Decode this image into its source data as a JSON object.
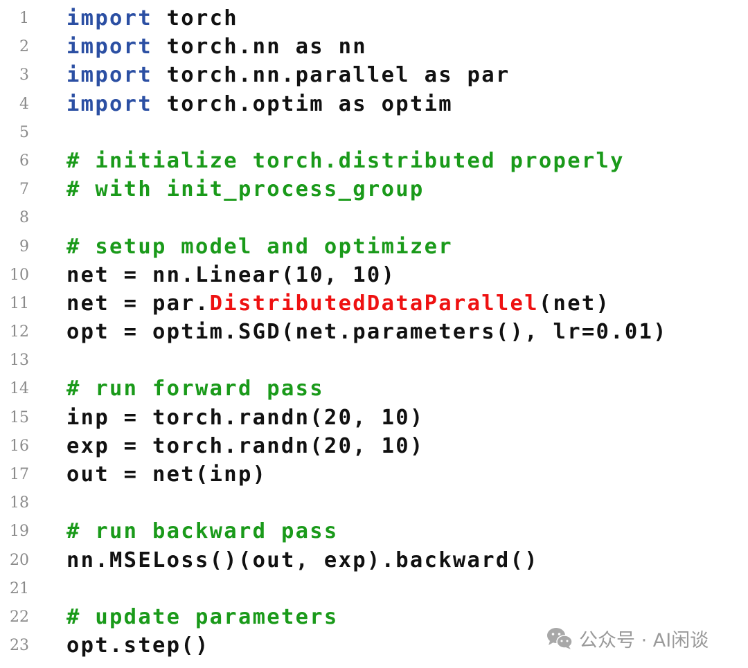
{
  "code": {
    "lines": [
      {
        "n": "1",
        "segs": [
          {
            "t": "import",
            "c": "kw"
          },
          {
            "t": " torch",
            "c": ""
          }
        ]
      },
      {
        "n": "2",
        "segs": [
          {
            "t": "import",
            "c": "kw"
          },
          {
            "t": " torch.nn as nn",
            "c": ""
          }
        ]
      },
      {
        "n": "3",
        "segs": [
          {
            "t": "import",
            "c": "kw"
          },
          {
            "t": " torch.nn.parallel as par",
            "c": ""
          }
        ]
      },
      {
        "n": "4",
        "segs": [
          {
            "t": "import",
            "c": "kw"
          },
          {
            "t": " torch.optim as optim",
            "c": ""
          }
        ]
      },
      {
        "n": "5",
        "segs": []
      },
      {
        "n": "6",
        "segs": [
          {
            "t": "# initialize torch.distributed properly",
            "c": "cm"
          }
        ]
      },
      {
        "n": "7",
        "segs": [
          {
            "t": "# with init_process_group",
            "c": "cm"
          }
        ]
      },
      {
        "n": "8",
        "segs": []
      },
      {
        "n": "9",
        "segs": [
          {
            "t": "# setup model and optimizer",
            "c": "cm"
          }
        ]
      },
      {
        "n": "10",
        "segs": [
          {
            "t": "net = nn.Linear(10, 10)",
            "c": ""
          }
        ]
      },
      {
        "n": "11",
        "segs": [
          {
            "t": "net = par.",
            "c": ""
          },
          {
            "t": "DistributedDataParallel",
            "c": "hl"
          },
          {
            "t": "(net)",
            "c": ""
          }
        ]
      },
      {
        "n": "12",
        "segs": [
          {
            "t": "opt = optim.SGD(net.parameters(), lr=0.01)",
            "c": ""
          }
        ]
      },
      {
        "n": "13",
        "segs": []
      },
      {
        "n": "14",
        "segs": [
          {
            "t": "# run forward pass",
            "c": "cm"
          }
        ]
      },
      {
        "n": "15",
        "segs": [
          {
            "t": "inp = torch.randn(20, 10)",
            "c": ""
          }
        ]
      },
      {
        "n": "16",
        "segs": [
          {
            "t": "exp = torch.randn(20, 10)",
            "c": ""
          }
        ]
      },
      {
        "n": "17",
        "segs": [
          {
            "t": "out = net(inp)",
            "c": ""
          }
        ]
      },
      {
        "n": "18",
        "segs": []
      },
      {
        "n": "19",
        "segs": [
          {
            "t": "# run backward pass",
            "c": "cm"
          }
        ]
      },
      {
        "n": "20",
        "segs": [
          {
            "t": "nn.MSELoss()(out, exp).backward()",
            "c": ""
          }
        ]
      },
      {
        "n": "21",
        "segs": []
      },
      {
        "n": "22",
        "segs": [
          {
            "t": "# update parameters",
            "c": "cm"
          }
        ]
      },
      {
        "n": "23",
        "segs": [
          {
            "t": "opt.step()",
            "c": ""
          }
        ]
      }
    ]
  },
  "watermark": {
    "icon": "wechat-icon",
    "text": "公众号 · AI闲谈"
  },
  "colors": {
    "keyword": "#2b4fa3",
    "comment": "#1a9a1a",
    "highlight": "#ee1111",
    "text": "#111111",
    "line_number": "#8a8a8a",
    "watermark": "#9a9a9a"
  }
}
